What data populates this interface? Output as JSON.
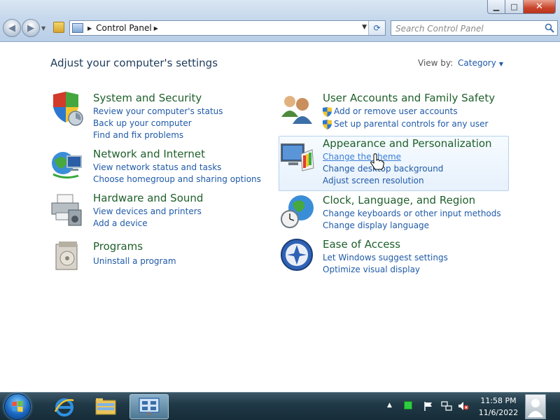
{
  "window": {
    "min_label": "▁",
    "max_label": "□",
    "close_label": "✕"
  },
  "address": {
    "path": "Control Panel",
    "search_placeholder": "Search Control Panel"
  },
  "page": {
    "title": "Adjust your computer's settings",
    "view_by_label": "View by:",
    "view_by_value": "Category"
  },
  "categories": [
    {
      "title": "System and Security",
      "links": [
        "Review your computer's status",
        "Back up your computer",
        "Find and fix problems"
      ]
    },
    {
      "title": "Network and Internet",
      "links": [
        "View network status and tasks",
        "Choose homegroup and sharing options"
      ]
    },
    {
      "title": "Hardware and Sound",
      "links": [
        "View devices and printers",
        "Add a device"
      ]
    },
    {
      "title": "Programs",
      "links": [
        "Uninstall a program"
      ]
    },
    {
      "title": "User Accounts and Family Safety",
      "links": [
        "Add or remove user accounts",
        "Set up parental controls for any user"
      ]
    },
    {
      "title": "Appearance and Personalization",
      "links": [
        "Change the theme",
        "Change desktop background",
        "Adjust screen resolution"
      ]
    },
    {
      "title": "Clock, Language, and Region",
      "links": [
        "Change keyboards or other input methods",
        "Change display language"
      ]
    },
    {
      "title": "Ease of Access",
      "links": [
        "Let Windows suggest settings",
        "Optimize visual display"
      ]
    }
  ],
  "taskbar": {
    "time": "11:58 PM",
    "date": "11/6/2022"
  },
  "colors": {
    "category_title": "#1e5f2a",
    "link": "#1f5aa8",
    "hover_border": "#b6d2ee"
  }
}
